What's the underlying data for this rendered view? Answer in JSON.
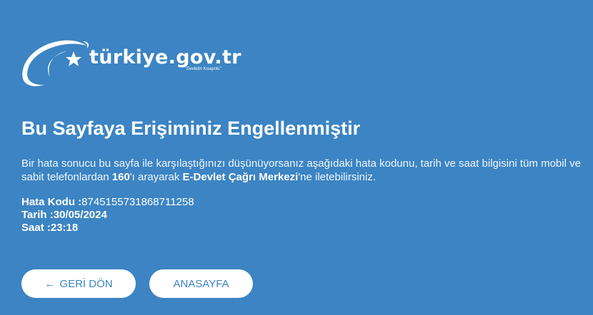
{
  "logo": {
    "name": "türkiye.gov.tr",
    "tagline": "\"Devletin Kısayolu\""
  },
  "title": "Bu Sayfaya Erişiminiz Engellenmiştir",
  "message": {
    "part1": "Bir hata sonucu bu sayfa ile karşılaştığınızı düşünüyorsanız aşağıdaki hata kodunu, tarih ve saat bilgisini tüm mobil ve sabit telefonlardan ",
    "phone": "160",
    "part2": "'ı arayarak ",
    "center": "E-Devlet Çağrı Merkezi",
    "part3": "'ne iletebilirsiniz."
  },
  "error": {
    "code_label": "Hata Kodu :",
    "code_value": "8745155731868711258",
    "date_label": "Tarih :",
    "date_value": "30/05/2024",
    "time_label": "Saat :",
    "time_value": "23:18"
  },
  "buttons": {
    "back_arrow": "←",
    "back": "GERİ DÖN",
    "home": "ANASAYFA"
  },
  "colors": {
    "background": "#3c84c3",
    "text": "#ffffff",
    "button_bg": "#ffffff",
    "button_text": "#3c84c3"
  }
}
